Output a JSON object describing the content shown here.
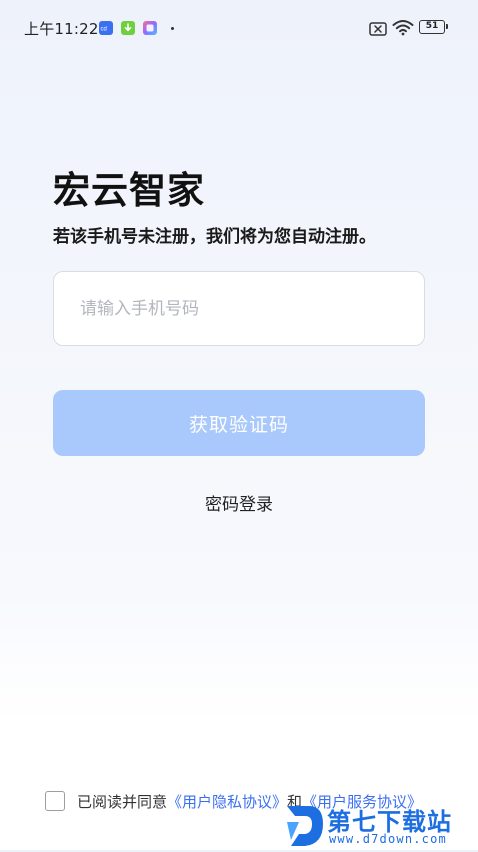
{
  "status_bar": {
    "time": "上午11:22",
    "battery": "51",
    "icons": [
      "app-icon-blue",
      "app-icon-green",
      "app-icon-gradient",
      "sim-off-icon",
      "wifi-icon",
      "battery-icon"
    ]
  },
  "login": {
    "title": "宏云智家",
    "subtitle": "若该手机号未注册，我们将为您自动注册。",
    "phone_placeholder": "请输入手机号码",
    "phone_value": "",
    "get_code_label": "获取验证码",
    "password_login_label": "密码登录"
  },
  "agreement": {
    "prefix": "已阅读并同意",
    "privacy_link": "《用户隐私协议》",
    "and": "和",
    "service_link": "《用户服务协议》",
    "checked": false
  },
  "watermark": {
    "title": "第七下载站",
    "url": "www.d7down.com"
  },
  "colors": {
    "accent": "#3b6ff2",
    "button_disabled": "#a9c8fb"
  }
}
